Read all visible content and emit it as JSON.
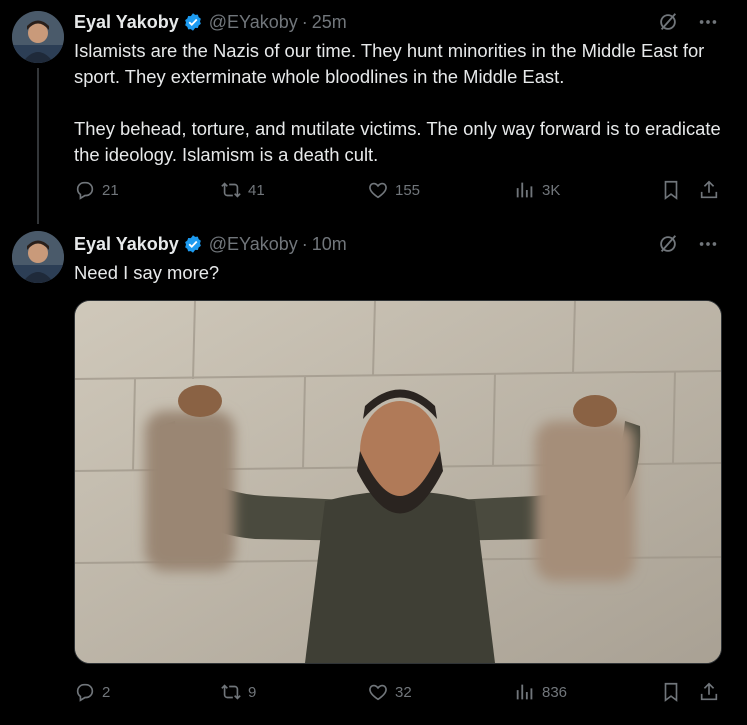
{
  "tweets": [
    {
      "author_name": "Eyal Yakoby",
      "handle": "@EYakoby",
      "separator": "·",
      "time": "25m",
      "text": "Islamists are the Nazis of our time. They hunt minorities in the Middle East for sport. They exterminate whole bloodlines in the Middle East.\n\nThey behead, torture, and mutilate victims. The only way forward is to eradicate the ideology. Islamism is a death cult.",
      "stats": {
        "replies": "21",
        "reposts": "41",
        "likes": "155",
        "views": "3K"
      }
    },
    {
      "author_name": "Eyal Yakoby",
      "handle": "@EYakoby",
      "separator": "·",
      "time": "10m",
      "text": "Need I say more?",
      "stats": {
        "replies": "2",
        "reposts": "9",
        "likes": "32",
        "views": "836"
      }
    }
  ],
  "icons": {
    "verified": "verified-badge-icon",
    "grok": "grok-icon",
    "more": "more-icon",
    "reply": "reply-icon",
    "repost": "repost-icon",
    "like": "heart-icon",
    "views": "views-icon",
    "bookmark": "bookmark-icon",
    "share": "share-icon"
  },
  "colors": {
    "background": "#000000",
    "text": "#e7e9ea",
    "muted": "#71767b",
    "verified": "#1d9bf0"
  }
}
